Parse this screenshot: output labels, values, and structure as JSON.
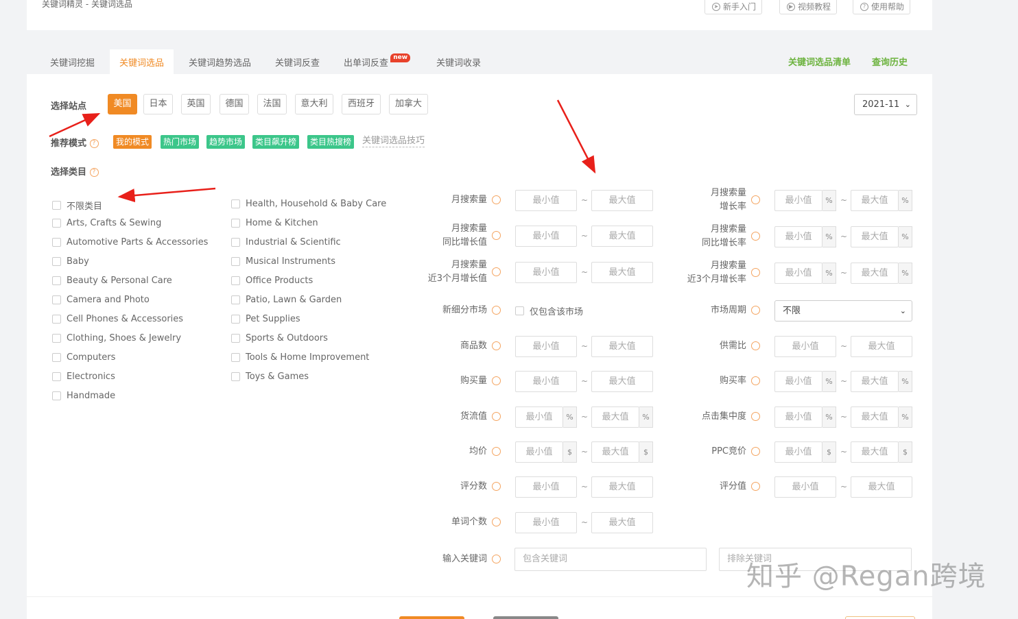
{
  "header": {
    "title": "关键词精灵 - 关键词选品",
    "buttons": [
      "新手入门",
      "视频教程",
      "使用帮助"
    ]
  },
  "tabs": [
    "关键词挖掘",
    "关键词选品",
    "关键词趋势选品",
    "关键词反查",
    "出单词反查",
    "关键词收录"
  ],
  "new_badge": "new",
  "right_links": [
    "关键词选品清单",
    "查询历史"
  ],
  "site": {
    "label": "选择站点",
    "options": [
      "美国",
      "日本",
      "英国",
      "德国",
      "法国",
      "意大利",
      "西班牙",
      "加拿大"
    ],
    "selected": "美国"
  },
  "month_select": "2021-11",
  "mode": {
    "label": "推荐模式",
    "tags": [
      "我的模式",
      "热门市场",
      "趋势市场",
      "类目飙升榜",
      "类目热搜榜"
    ],
    "tag_colors": [
      "#f08a24",
      "#3cc68a",
      "#3cc68a",
      "#3cc68a",
      "#3cc68a"
    ],
    "tips_link": "关键词选品技巧"
  },
  "category": {
    "label": "选择类目",
    "col1": [
      "不限类目",
      "Arts, Crafts & Sewing",
      "Automotive Parts & Accessories",
      "Baby",
      "Beauty & Personal Care",
      "Camera and Photo",
      "Cell Phones & Accessories",
      "Clothing, Shoes & Jewelry",
      "Computers",
      "Electronics",
      "Handmade"
    ],
    "col2": [
      "Health, Household & Baby Care",
      "Home & Kitchen",
      "Industrial & Scientific",
      "Musical Instruments",
      "Office Products",
      "Patio, Lawn & Garden",
      "Pet Supplies",
      "Sports & Outdoors",
      "Tools & Home Improvement",
      "Toys & Games"
    ]
  },
  "filters": {
    "min": "最小值",
    "max": "最大值",
    "left": [
      {
        "label": [
          "月搜索量"
        ],
        "suffix": ""
      },
      {
        "label": [
          "月搜索量",
          "同比增长值"
        ],
        "suffix": ""
      },
      {
        "label": [
          "月搜索量",
          "近3个月增长值"
        ],
        "suffix": ""
      },
      {
        "label": [
          "新细分市场"
        ],
        "suffix": ""
      },
      {
        "label": [
          "商品数"
        ],
        "suffix": ""
      },
      {
        "label": [
          "购买量"
        ],
        "suffix": ""
      },
      {
        "label": [
          "货流值"
        ],
        "suffix": "%"
      },
      {
        "label": [
          "均价"
        ],
        "suffix": "$"
      },
      {
        "label": [
          "评分数"
        ],
        "suffix": ""
      },
      {
        "label": [
          "单词个数"
        ],
        "suffix": ""
      }
    ],
    "right": [
      {
        "label": [
          "月搜索量",
          "增长率"
        ],
        "suffix": "%"
      },
      {
        "label": [
          "月搜索量",
          "同比增长率"
        ],
        "suffix": "%"
      },
      {
        "label": [
          "月搜索量",
          "近3个月增长率"
        ],
        "suffix": "%"
      },
      {
        "label": [
          "市场周期"
        ],
        "suffix": ""
      },
      {
        "label": [
          "供需比"
        ],
        "suffix": ""
      },
      {
        "label": [
          "购买率"
        ],
        "suffix": "%"
      },
      {
        "label": [
          "点击集中度"
        ],
        "suffix": "%"
      },
      {
        "label": [
          "PPC竞价"
        ],
        "suffix": "$"
      },
      {
        "label": [
          "评分值"
        ],
        "suffix": ""
      }
    ],
    "new_market_checkbox": "仅包含该市场",
    "market_cycle_value": "不限",
    "keyword_label": "输入关键词",
    "include_placeholder": "包含关键词",
    "exclude_placeholder": "排除关键词"
  },
  "watermark": "知乎 @Regan跨境"
}
